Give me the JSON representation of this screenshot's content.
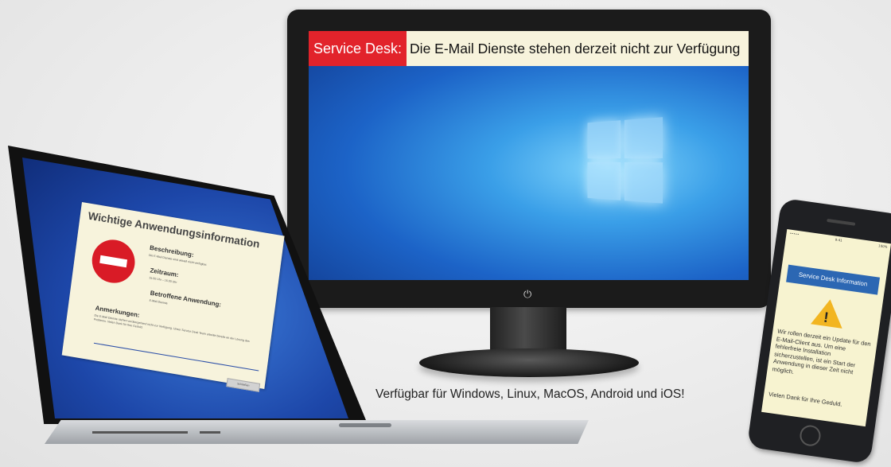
{
  "monitor": {
    "banner_tag": "Service Desk:",
    "banner_message": "Die E-Mail Dienste stehen derzeit nicht zur Verfügung",
    "power_icon": "power-icon"
  },
  "laptop": {
    "dialog_title": "Wichtige Anwendungsinformation",
    "description_label": "Beschreibung:",
    "description_text": "Die E-Mail Dienste sind aktuell nicht verfügbar.",
    "period_label": "Zeitraum:",
    "period_text": "15.00 Uhr – 16.00 Uhr",
    "affected_label": "Betroffene Anwendung:",
    "affected_text": "E-Mail Dienste",
    "remarks_label": "Anmerkungen:",
    "remarks_text": "Die E-Mail Dienste stehen vorübergehend nicht zur Verfügung. Unser Service Desk Team arbeitet bereits an der Lösung des Problems. Vielen Dank für Ihre Geduld.",
    "ok_label": "Schließen"
  },
  "phone": {
    "carrier": "•••••",
    "time": "9:41",
    "battery": "100%",
    "banner": "Service Desk Information",
    "message": "Wir rollen derzeit ein Update für den E-Mail-Client aus. Um eine fehlerfreie Installation sicherzustellen, ist ein Start der Anwendung in dieser Zeit nicht möglich.",
    "thanks": "Vielen Dank für Ihre Geduld."
  },
  "caption": "Verfügbar für Windows, Linux, MacOS, Android und iOS!"
}
